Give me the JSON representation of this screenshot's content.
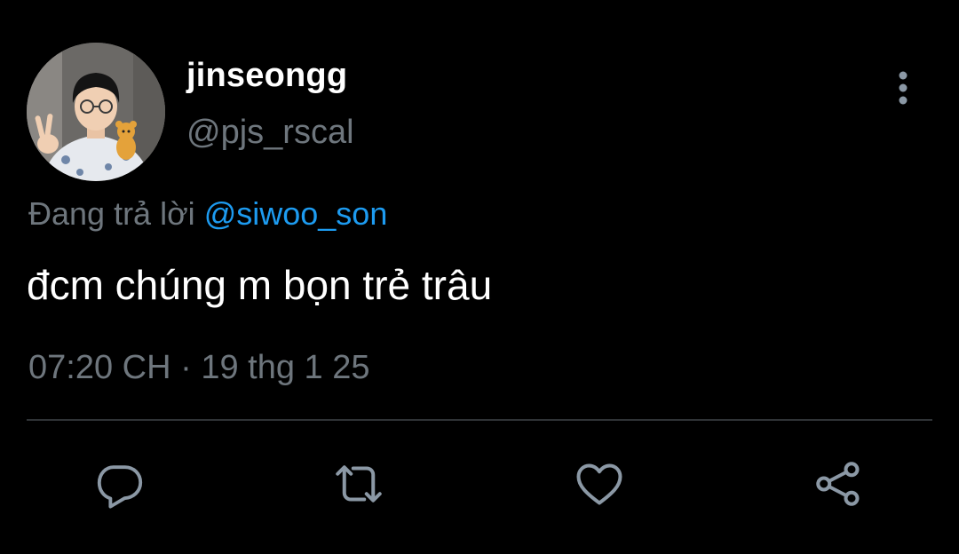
{
  "user": {
    "display_name": "jinseongg",
    "handle": "@pjs_rscal"
  },
  "reply": {
    "prefix": "Đang trả lời ",
    "mention": "@siwoo_son"
  },
  "tweet": {
    "text": "đcm chúng m bọn trẻ trâu"
  },
  "meta": {
    "time": "07:20 CH",
    "separator": " · ",
    "date": "19 thg 1 25"
  },
  "actions": [
    {
      "icon": "reply-icon"
    },
    {
      "icon": "retweet-icon"
    },
    {
      "icon": "like-icon"
    },
    {
      "icon": "share-icon"
    }
  ],
  "colors": {
    "background": "#000000",
    "primary_text": "#ffffff",
    "secondary_text": "#6e767d",
    "accent": "#1d9bf0",
    "divider": "#2f3336"
  }
}
